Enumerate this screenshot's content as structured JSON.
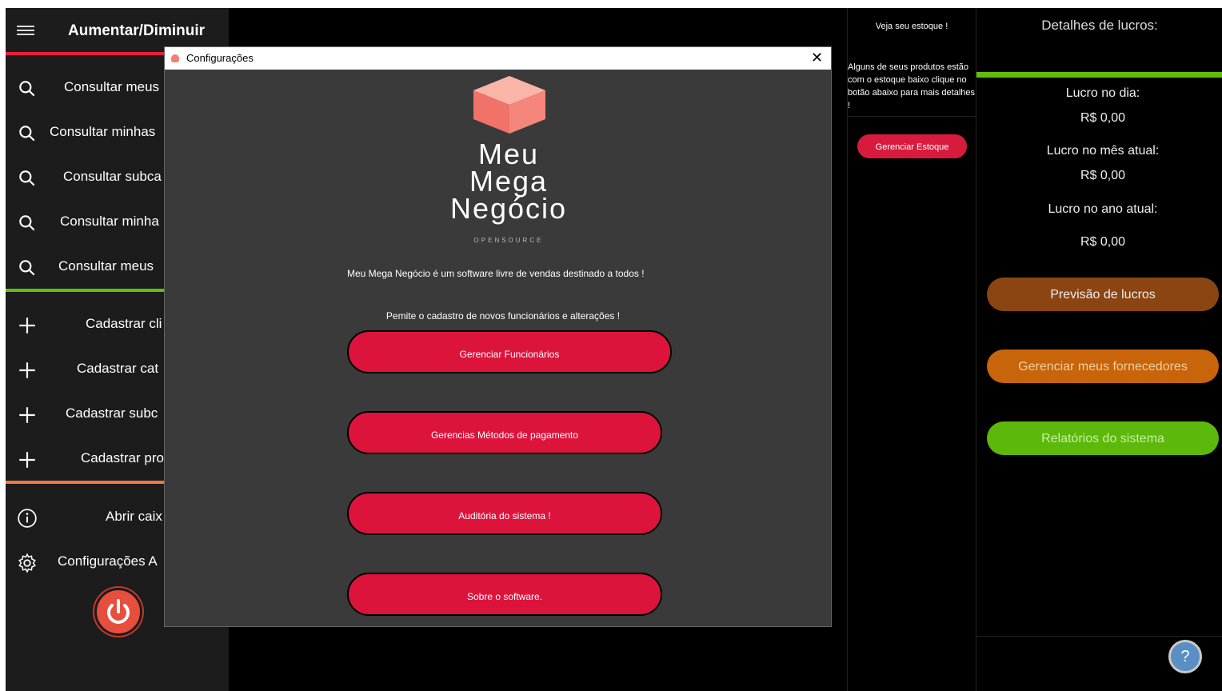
{
  "sidebar": {
    "title": "Aumentar/Diminuir",
    "items": [
      {
        "label": "Consultar meus",
        "icon": "search-icon"
      },
      {
        "label": "Consultar minhas",
        "icon": "search-icon"
      },
      {
        "label": "Consultar subca",
        "icon": "search-icon"
      },
      {
        "label": "Consultar minha",
        "icon": "search-icon"
      },
      {
        "label": "Consultar meus",
        "icon": "search-icon"
      },
      {
        "label": "Cadastrar cli",
        "icon": "plus-icon"
      },
      {
        "label": "Cadastrar cat",
        "icon": "plus-icon"
      },
      {
        "label": "Cadastrar subc",
        "icon": "plus-icon"
      },
      {
        "label": "Cadastrar pro",
        "icon": "plus-icon"
      },
      {
        "label": "Abrir caix",
        "icon": "info-icon"
      },
      {
        "label": "Configurações A",
        "icon": "gear-icon"
      }
    ],
    "colors": {
      "red": "#e8203c",
      "green": "#5fbf0a",
      "orange": "#f07840"
    }
  },
  "stock": {
    "title": "Veja seu estoque !",
    "message": "Alguns de seus produtos estão com o estoque baixo clique no botão abaixo para mais detalhes !",
    "button": "Gerenciar Estoque"
  },
  "profit": {
    "title": "Detalhes de lucros:",
    "day_label": "Lucro no dia:",
    "day_value": "R$ 0,00",
    "month_label": "Lucro no mês atual:",
    "month_value": "R$ 0,00",
    "year_label": "Lucro no ano atual:",
    "year_value": "R$ 0,00",
    "buttons": [
      {
        "label": "Previsão de lucros",
        "color": "#8b4513"
      },
      {
        "label": "Gerenciar meus fornecedores",
        "color": "#c8640a"
      },
      {
        "label": "Relatórios do sistema",
        "color": "#5cb80a"
      }
    ],
    "help": "?"
  },
  "dialog": {
    "title": "Configurações",
    "close": "✕",
    "logo_line1": "Meu",
    "logo_line2": "Mega",
    "logo_line3": "Negócio",
    "logo_sub": "OPENSOURCE",
    "description": "Meu Mega Negócio é um software livre de vendas destinado a todos !",
    "subdescription": "Pemite o cadastro de novos funcionários e alterações !",
    "buttons": [
      "Gerenciar Funcionários",
      "Gerencias Métodos de pagamento",
      "Auditória do sistema !",
      "Sobre o software."
    ]
  }
}
